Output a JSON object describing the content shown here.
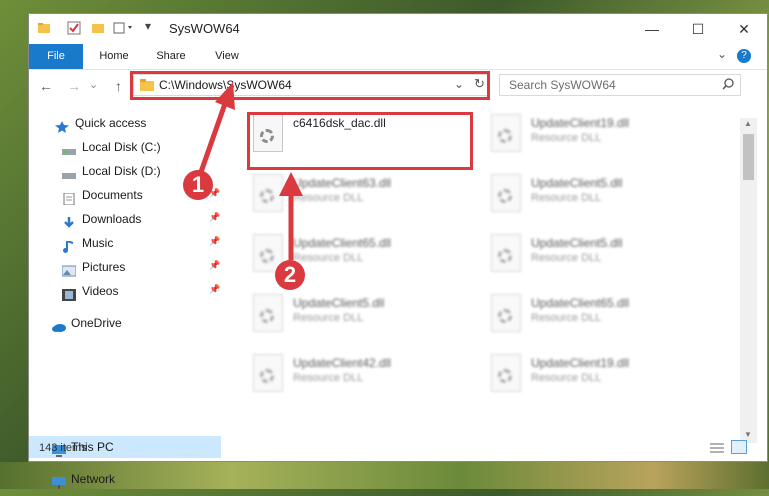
{
  "window": {
    "title": "SysWOW64",
    "controls": {
      "minimize": "—",
      "maximize": "☐",
      "close": "✕"
    }
  },
  "ribbon": {
    "tabs": [
      {
        "label": "File"
      },
      {
        "label": "Home"
      },
      {
        "label": "Share"
      },
      {
        "label": "View"
      }
    ],
    "expand": "⌄",
    "help": "?"
  },
  "nav": {
    "back": "←",
    "forward": "→",
    "history": "⌄",
    "up": "↑"
  },
  "address": {
    "path": "C:\\Windows\\SysWOW64",
    "dropdown": "⌄",
    "refresh": "↻"
  },
  "search": {
    "placeholder": "Search SysWOW64"
  },
  "sidebar": {
    "items": [
      {
        "label": "Quick access",
        "icon": "star-icon"
      },
      {
        "label": "Local Disk (C:)",
        "icon": "drive-icon"
      },
      {
        "label": "Local Disk (D:)",
        "icon": "drive-icon"
      },
      {
        "label": "Documents",
        "icon": "document-icon"
      },
      {
        "label": "Downloads",
        "icon": "download-icon"
      },
      {
        "label": "Music",
        "icon": "music-icon"
      },
      {
        "label": "Pictures",
        "icon": "picture-icon"
      },
      {
        "label": "Videos",
        "icon": "video-icon"
      },
      {
        "label": "OneDrive",
        "icon": "cloud-icon"
      },
      {
        "label": "This PC",
        "icon": "computer-icon"
      },
      {
        "label": "Network",
        "icon": "network-icon"
      }
    ]
  },
  "files": [
    {
      "name": "c6416dsk_dac.dll",
      "type": ""
    },
    {
      "name": "UpdateClient19.dll",
      "type": "Resource DLL"
    },
    {
      "name": "UpdateClient63.dll",
      "type": "Resource DLL"
    },
    {
      "name": "UpdateClient5.dll",
      "type": "Resource DLL"
    },
    {
      "name": "UpdateClient65.dll",
      "type": "Resource DLL"
    },
    {
      "name": "UpdateClient5.dll",
      "type": "Resource DLL"
    },
    {
      "name": "UpdateClient5.dll",
      "type": "Resource DLL"
    },
    {
      "name": "UpdateClient65.dll",
      "type": "Resource DLL"
    },
    {
      "name": "UpdateClient42.dll",
      "type": "Resource DLL"
    },
    {
      "name": "UpdateClient19.dll",
      "type": "Resource DLL"
    }
  ],
  "status": {
    "count": "143 items"
  },
  "annotations": {
    "badge1": "1",
    "badge2": "2"
  },
  "colors": {
    "accent": "#1979ca",
    "highlight": "#d9393f",
    "selection": "#cce8ff"
  }
}
